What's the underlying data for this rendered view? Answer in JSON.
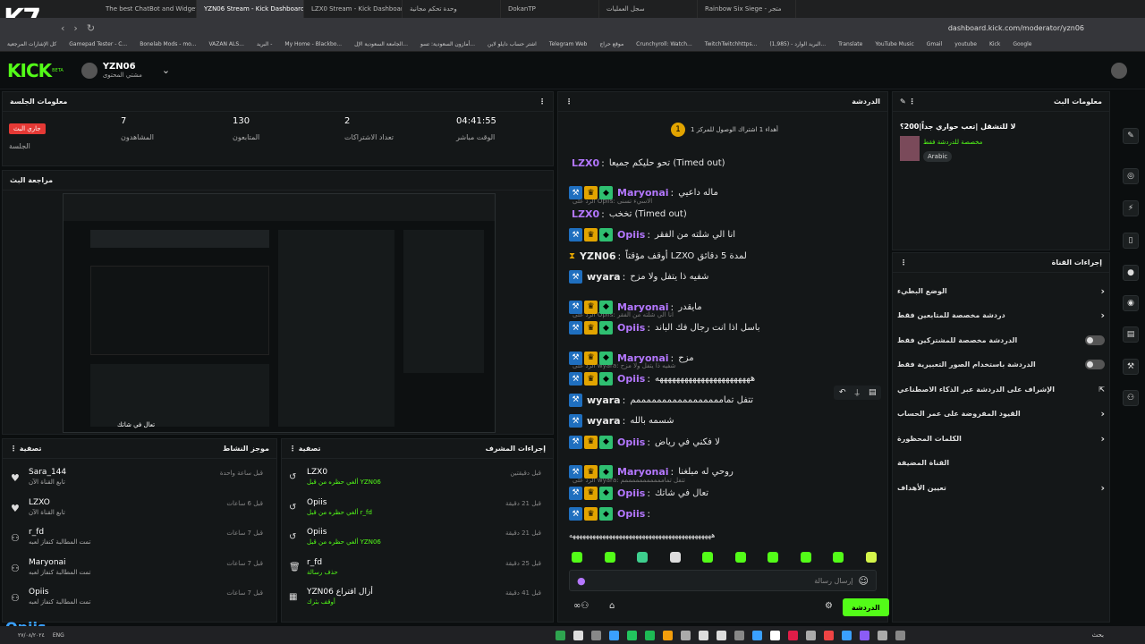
{
  "browser": {
    "tabs": [
      {
        "label": "Rainbow Six Siege - متجر",
        "active": false
      },
      {
        "label": "سجل العمليات",
        "active": false
      },
      {
        "label": "DokanTP",
        "active": false
      },
      {
        "label": "وحدة تحكم مجانية",
        "active": false
      },
      {
        "label": "LZX0 Stream - Kick Dashboard",
        "active": false
      },
      {
        "label": "YZN06 Stream - Kick Dashboard",
        "active": true
      },
      {
        "label": "The best ChatBot and Widgets",
        "active": false
      }
    ],
    "url": "dashboard.kick.com/moderator/yzn06",
    "bookmarks": [
      "Gamepad Tester - C...",
      "Bonelab Mods - mo...",
      "VAZAN ALS...",
      "البريد -",
      "My Home - Blackbo...",
      "الجامعة السعودية الإل...",
      "أمازون السعودية: تسو...",
      "اشتر حساب دايلو لاين",
      "Telegram Web",
      "موقع حراج",
      "Crunchyroll: Watch...",
      "TwitchTwitchhttps...",
      "(1,985) - البريد الوارد...",
      "Translate",
      "YouTube Music",
      "Gmail",
      "youtube",
      "Kick",
      "Google"
    ],
    "bookmarks_right": "كل الإشارات المرجعية"
  },
  "header": {
    "logo": "KICK",
    "logo_beta": "BETA",
    "channel_name": "YZN06",
    "channel_sub": "مشتي المحتوى"
  },
  "session": {
    "title": "معلومات الجلسة",
    "stats": [
      {
        "value": "04:41:55",
        "label": "الوقت مباشر"
      },
      {
        "value": "2",
        "label": "تعداد الاشتراكات"
      },
      {
        "value": "130",
        "label": "المتابعون"
      },
      {
        "value": "7",
        "label": "المشاهدون"
      }
    ],
    "live_badge": "جاري البث",
    "live_label": "الجلسة"
  },
  "preview": {
    "title": "مراجعة البث"
  },
  "chat": {
    "title": "الدردشة",
    "pinned": "أهداء 1 اشتراك الوصول للمركز 1",
    "lines": [
      {
        "user": "LZX0",
        "text": "تحو حليكم جميعا (Timed out)",
        "badges": [],
        "color": "purple"
      },
      {
        "reply": "الرد على Opiis: الاسيء تسنى"
      },
      {
        "user": "Maryonai",
        "text": "ماله داعيي",
        "badges": [
          "mod",
          "crown",
          "sub"
        ],
        "color": "purple"
      },
      {
        "user": "LZX0",
        "text": "تخخب (Timed out)",
        "badges": [],
        "color": "purple"
      },
      {
        "user": "Opiis",
        "text": "انا الي شلته من الفقر",
        "badges": [
          "mod",
          "crown",
          "sub"
        ],
        "color": "purple"
      },
      {
        "user": "YZN06",
        "text": "أوقف مؤقتاً LZXO لمدة 5 دقائق",
        "badges": [
          "hourglass"
        ],
        "color": "white"
      },
      {
        "user": "wyara",
        "text": "شفيه ذا يتفل ولا مزح",
        "badges": [
          "mod"
        ],
        "color": "white"
      },
      {
        "reply": "الرد على Opiis: انا الي شلته من الفقر"
      },
      {
        "user": "Maryonai",
        "text": "مايقدر",
        "badges": [
          "mod",
          "crown",
          "sub"
        ],
        "color": "purple"
      },
      {
        "user": "Opiis",
        "text": "باسل اذا انت رجال فك الباند",
        "badges": [
          "mod",
          "crown",
          "sub"
        ],
        "color": "purple"
      },
      {
        "reply": "الرد على wyara: شفيه ذا يتفل ولا مزح"
      },
      {
        "user": "Maryonai",
        "text": "مزح",
        "badges": [
          "mod",
          "crown",
          "sub"
        ],
        "color": "purple"
      },
      {
        "user": "Opiis",
        "text": "هههههههههههههههههههههههه",
        "badges": [
          "mod",
          "crown",
          "sub"
        ],
        "color": "purple"
      },
      {
        "user": "wyara",
        "text": "تتفل تمامممممممممممممممممم",
        "badges": [
          "mod"
        ],
        "color": "white"
      },
      {
        "user": "wyara",
        "text": "شسمه بالله",
        "badges": [
          "mod"
        ],
        "color": "white"
      },
      {
        "user": "Opiis",
        "text": "لا فكني في رياض",
        "badges": [
          "mod",
          "crown",
          "sub"
        ],
        "color": "purple"
      },
      {
        "reply": "الرد على wyara: تتفل تمامممممممممممم"
      },
      {
        "user": "Maryonai",
        "text": "روحي له مبلغنا",
        "badges": [
          "mod",
          "crown",
          "sub"
        ],
        "color": "purple"
      },
      {
        "user": "Opiis",
        "text": "تعال في شاتك",
        "badges": [
          "mod",
          "crown",
          "sub"
        ],
        "color": "purple"
      },
      {
        "user": "Opiis",
        "text": "",
        "badges": [
          "mod",
          "crown",
          "sub"
        ],
        "color": "purple"
      },
      {
        "text_only": "هههههههههههههههههههههههههههههههههههههههههههه"
      }
    ],
    "input_placeholder": "إرسال رسالة",
    "send_label": "الدردشة"
  },
  "stream_info": {
    "title": "معلومات البث",
    "stream_title": "لا للتشقل |تعب حواري جداً|200؟",
    "category": "مخصصة للدردشة فقط",
    "tag": "Arabic"
  },
  "channel_actions": {
    "title": "إجراءات القناة",
    "items": [
      {
        "label": "الوضع البطيء",
        "control": "chevron"
      },
      {
        "label": "دردشة مخصصة للمتابعين فقط",
        "control": "chevron"
      },
      {
        "label": "الدردشة مخصصة للمشتركين فقط",
        "control": "toggle"
      },
      {
        "label": "الدردشة باستخدام الصور التعبيرية فقط",
        "control": "toggle"
      },
      {
        "label": "الإشراف على الدردشة عبر الذكاء الاصطناعي",
        "control": "external"
      },
      {
        "label": "القيود المفروضة على عمر الحساب",
        "control": "chevron"
      },
      {
        "label": "الكلمات المحظورة",
        "control": "chevron"
      },
      {
        "label": "القناة المضيفة",
        "control": "none"
      },
      {
        "label": "تعيين الأهداف",
        "control": "chevron"
      }
    ]
  },
  "activity": {
    "title": "موجز النشاط",
    "filter": "تصفية",
    "items": [
      {
        "name": "Sara_144",
        "sub": "تابع القناة الآن",
        "time": "قبل ساعة واحدة"
      },
      {
        "name": "LZXO",
        "sub": "تابع القناة الآن",
        "time": "قبل 6 ساعات"
      },
      {
        "name": "r_fd",
        "sub": "تمت المطالبة كنفاز لعبه",
        "time": "قبل 7 ساعات"
      },
      {
        "name": "Maryonai",
        "sub": "تمت المطالبة كنفاز لعبه",
        "time": "قبل 7 ساعات"
      },
      {
        "name": "Opiis",
        "sub": "تمت المطالبة كنفاز لعبه",
        "time": "قبل 7 ساعات"
      }
    ]
  },
  "mod_actions": {
    "title": "إجراءات المشرف",
    "filter": "تصفية",
    "items": [
      {
        "name": "LZX0",
        "sub": "ألغي حظره من قبل YZN06",
        "time": "قبل دقيقتين",
        "icon": "undo-icon"
      },
      {
        "name": "Opiis",
        "sub": "ألغي حظره من قبل r_fd",
        "time": "قبل 21 دقيقة",
        "icon": "undo-icon"
      },
      {
        "name": "Opiis",
        "sub": "ألغي حظره من قبل YZN06",
        "time": "قبل 21 دقيقة",
        "icon": "undo-icon"
      },
      {
        "name": "r_fd",
        "sub": "حذف رسالة",
        "time": "قبل 25 دقيقة",
        "icon": "trash-icon"
      },
      {
        "name": "YZN06 أزال اقتراع",
        "sub": "أوقف بثرك",
        "time": "قبل 41 دقيقة",
        "icon": "poll-icon"
      }
    ]
  },
  "overlay_text": {
    "watermark_name": "Opiis",
    "stream_overlay": "تعال في شاتك"
  },
  "taskbar": {
    "clock": "٢٧/٠٨/٢٠٢٤",
    "lang": "ENG",
    "search": "بحث"
  }
}
